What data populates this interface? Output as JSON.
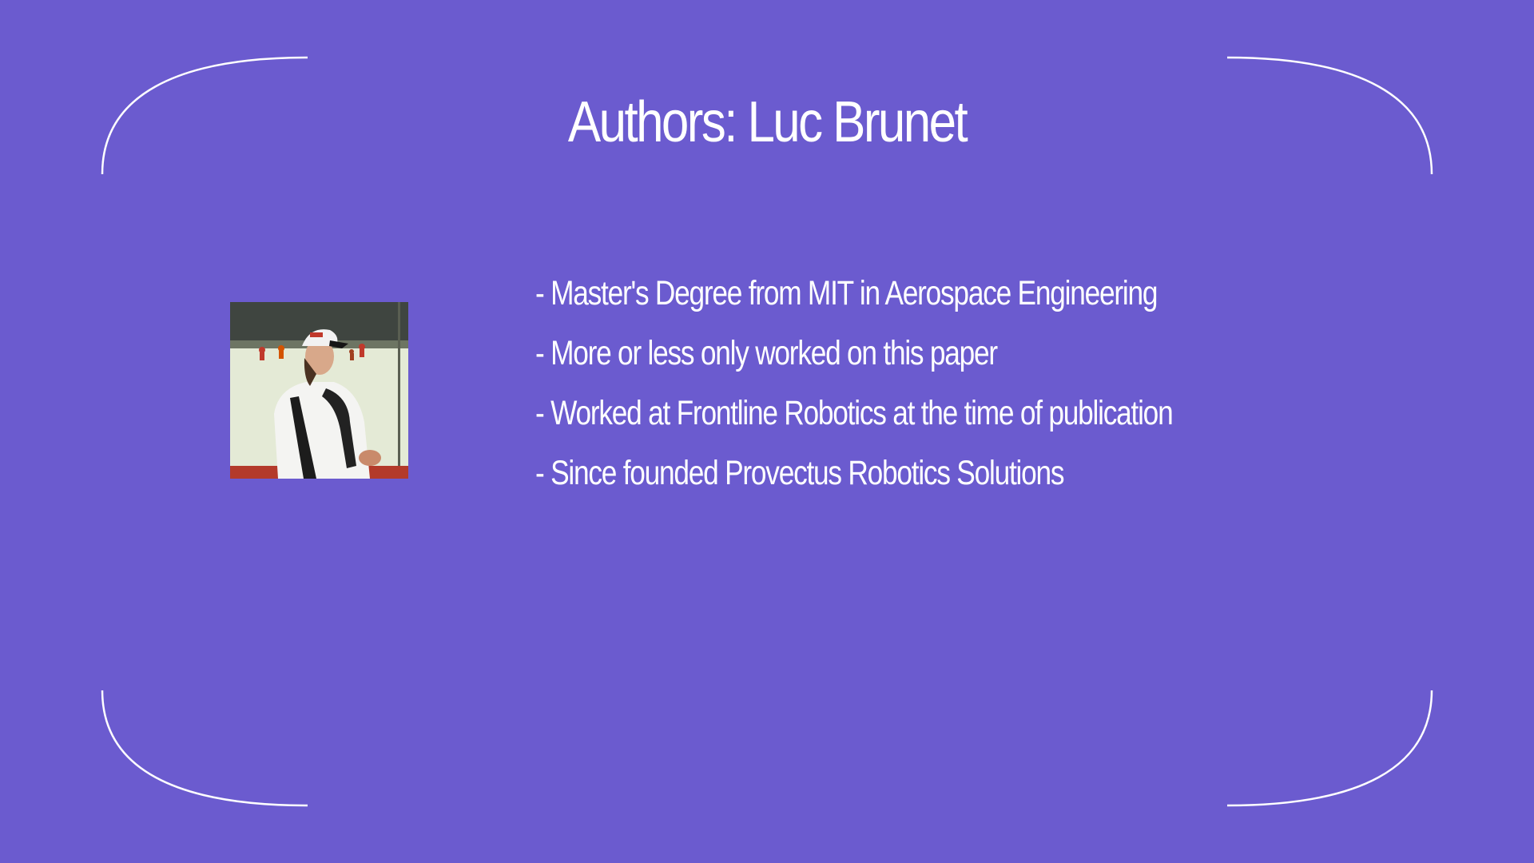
{
  "slide": {
    "title": "Authors: Luc Brunet",
    "bullets": [
      "- Master's Degree from MIT in Aerospace Engineering",
      "- More or less only worked on this paper",
      "- Worked at Frontline Robotics at the time of publication",
      "- Since founded Provectus Robotics Solutions"
    ]
  },
  "colors": {
    "background": "#6b5bcf",
    "text": "#ffffff",
    "frame": "#ffffff"
  }
}
